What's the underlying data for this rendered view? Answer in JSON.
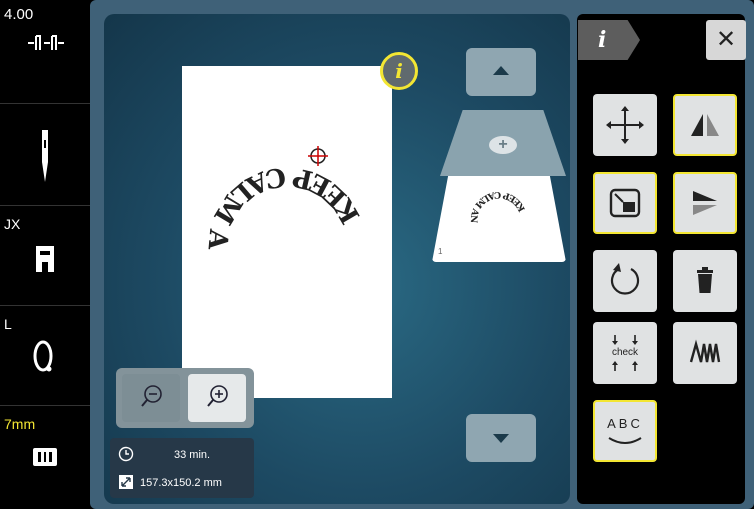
{
  "sidebar": {
    "tension_value": "4.00",
    "presser_foot_label": "JX",
    "hoop_label": "L",
    "stitch_length_label": "7mm"
  },
  "status": {
    "time": "33 min.",
    "size": "157.3x150.2 mm"
  },
  "design": {
    "text": "KEEP CALM AND SEW ON"
  },
  "thumbnail": {
    "index": "1"
  },
  "panel": {
    "info_tab": "i",
    "close": "✕",
    "check_label": "check",
    "abc_label": "ABC"
  },
  "colors": {
    "accent": "#f3e633",
    "frame": "#3f6178",
    "sidebar": "#000000",
    "seven_mm": "#f3e633"
  },
  "icons": [
    "tension-icon",
    "needle-icon",
    "presser-foot-icon",
    "hoop-icon",
    "stitch-plate-icon",
    "info-icon",
    "arrow-up-icon",
    "plus-icon",
    "arrow-down-icon",
    "zoom-out-icon",
    "zoom-in-icon",
    "clock-icon",
    "resize-icon",
    "move-icon",
    "mirror-horizontal-icon",
    "scale-icon",
    "mirror-vertical-icon",
    "rotate-icon",
    "trash-icon",
    "check-center-icon",
    "stitch-density-icon",
    "curve-text-icon",
    "close-icon"
  ]
}
